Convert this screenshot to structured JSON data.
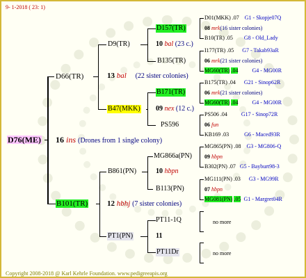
{
  "header": "9- 1-2018 ( 23: 1)",
  "footer": "Copyright 2008-2018 @ Karl Kehrle Foundation.  www.pedigreeapis.org",
  "root": {
    "id": "D76(ME)",
    "gen": "16",
    "tag": "ins",
    "note": "(Drones from 1 single colony)"
  },
  "mother": {
    "id": "D66(TR)",
    "gen": "13",
    "tag": "bal",
    "note": "(22 sister colonies)"
  },
  "father_side": {
    "id": "B101(TR)",
    "gen": "12",
    "tag": "hbhj",
    "note": "(7 sister colonies)"
  },
  "mm": {
    "id": "D9(TR)",
    "gen": "10",
    "tag": "bal",
    "note": "(23 c.)"
  },
  "mf": {
    "id": "B47(MKK)",
    "gen": "09",
    "tag": "nex",
    "note": "(12 c.)"
  },
  "fm": {
    "id": "B861(PN)",
    "gen": "10",
    "tag": "hbpn"
  },
  "ff": {
    "id": "PT1(PN)",
    "gen": "11"
  },
  "g3": {
    "d157": "D157(TR)",
    "b135": "B135(TR)",
    "b171": "B171(TR)",
    "ps596": "PS596",
    "mg866a": "MG866a(PN)",
    "b113": "B113(PN)",
    "pt11q": "PT11-1Q",
    "pt11dr": "PT11Dr"
  },
  "g4": [
    {
      "id": "D01(MKK)",
      "yr": ".07",
      "ref": "G1 - Skopje07Q"
    },
    {
      "id": "08",
      "tag": "mrk",
      "note": "(16 sister colonies)"
    },
    {
      "id": "B10(TR)",
      "yr": ".05",
      "ref": "G8 - Old_Lady"
    },
    {
      "id": "I177(TR)",
      "yr": ".05",
      "ref": "G7 - Takab93aR"
    },
    {
      "id": "06",
      "tag": "mrk",
      "note": "(21 sister colonies)"
    },
    {
      "id": "MG60(TR)",
      "yr": ".04",
      "ref": "G4 - MG00R"
    },
    {
      "id": "B175(TR)",
      "yr": ".04",
      "ref": "G21 - Sinop62R"
    },
    {
      "id": "06",
      "tag": "mrk",
      "note": "(21 sister colonies)"
    },
    {
      "id": "MG60(TR)",
      "yr": ".04",
      "ref": "G4 - MG00R"
    },
    {
      "id": "PS506",
      "yr": ".04",
      "ref": "G17 - Sinop72R"
    },
    {
      "id": "06",
      "tag": "fun"
    },
    {
      "id": "KB169",
      "yr": ".03",
      "ref": "G6 - Maced93R"
    },
    {
      "id": "MG865(PN)",
      "yr": ".08",
      "ref": "G3 - MG806-Q"
    },
    {
      "id": "09",
      "tag": "hbpn"
    },
    {
      "id": "B302(PN)",
      "yr": ".07",
      "ref": "G5 - Bayburt98-3"
    },
    {
      "id": "MG111(PN)",
      "yr": ".03",
      "ref": "G3 - MG99R"
    },
    {
      "id": "07",
      "tag": "hbpn"
    },
    {
      "id": "MG081(PN)",
      "yr": ".05",
      "ref": "G1 - Margret04R"
    }
  ],
  "no_more": "no more"
}
